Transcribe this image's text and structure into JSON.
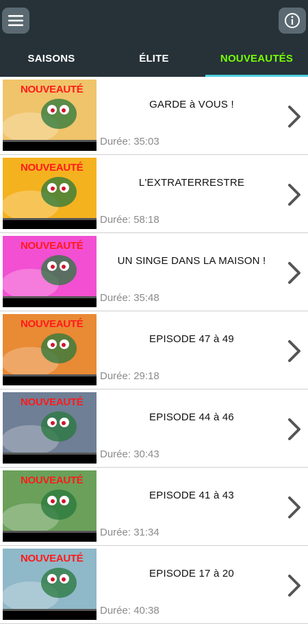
{
  "header": {
    "menu_icon": "hamburger-menu-icon",
    "info_icon": "info-icon"
  },
  "tabs": [
    {
      "label": "SAISONS"
    },
    {
      "label": "ÉLITE"
    },
    {
      "label": "NOUVEAUTÉS",
      "active": true
    }
  ],
  "colors": {
    "bar_background": "#263238",
    "active_tab": "#76ff03",
    "tab_indicator": "#4dd0e1",
    "badge": "#ff1a1a"
  },
  "episodes": [
    {
      "badge": "NOUVEAUTÉ",
      "title": "GARDE à VOUS !",
      "duration": "Durée: 35:03",
      "thumb_bg": "#f0c46a"
    },
    {
      "badge": "NOUVEAUTÉ",
      "title": "L'EXTRATERRESTRE",
      "duration": "Durée: 58:18",
      "thumb_bg": "#f5b21f"
    },
    {
      "badge": "NOUVEAUTÉ",
      "title": "UN SINGE DANS LA MAISON !",
      "duration": "Durée: 35:48",
      "thumb_bg": "#f24fd2"
    },
    {
      "badge": "NOUVEAUTÉ",
      "title": "EPISODE 47 à 49",
      "duration": "Durée: 29:18",
      "thumb_bg": "#e98a35"
    },
    {
      "badge": "NOUVEAUTÉ",
      "title": "EPISODE 44 à 46",
      "duration": "Durée: 30:43",
      "thumb_bg": "#6f7f96"
    },
    {
      "badge": "NOUVEAUTÉ",
      "title": "EPISODE 41 à 43",
      "duration": "Durée: 31:34",
      "thumb_bg": "#6aa05a"
    },
    {
      "badge": "NOUVEAUTÉ",
      "title": "EPISODE 17 à 20",
      "duration": "Durée: 40:38",
      "thumb_bg": "#8fb8c8"
    }
  ]
}
